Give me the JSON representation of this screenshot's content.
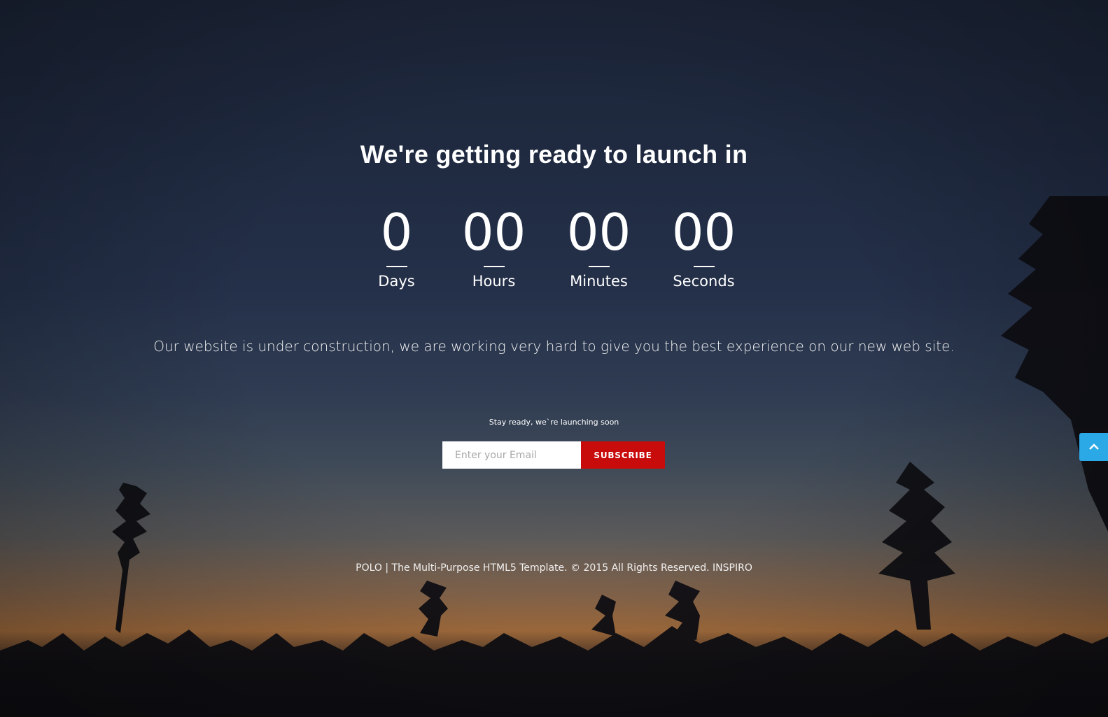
{
  "headline": "We're getting ready to launch in",
  "countdown": [
    {
      "value": "0",
      "label": "Days"
    },
    {
      "value": "00",
      "label": "Hours"
    },
    {
      "value": "00",
      "label": "Minutes"
    },
    {
      "value": "00",
      "label": "Seconds"
    }
  ],
  "description": "Our website is under construction, we are working very hard to give you the best experience on our new web site.",
  "newsletter": {
    "note": "Stay ready, we`re launching soon",
    "email_placeholder": "Enter your Email",
    "subscribe_label": "SUBSCRIBE"
  },
  "footer": {
    "text": "POLO | The Multi-Purpose HTML5 Template. © 2015 All Rights Reserved. INSPIRO"
  },
  "back_to_top": {
    "icon": "chevron-up-icon",
    "color": "#2ba9e6"
  },
  "colors": {
    "subscribe": "#c80c0c",
    "text": "#ffffff"
  }
}
